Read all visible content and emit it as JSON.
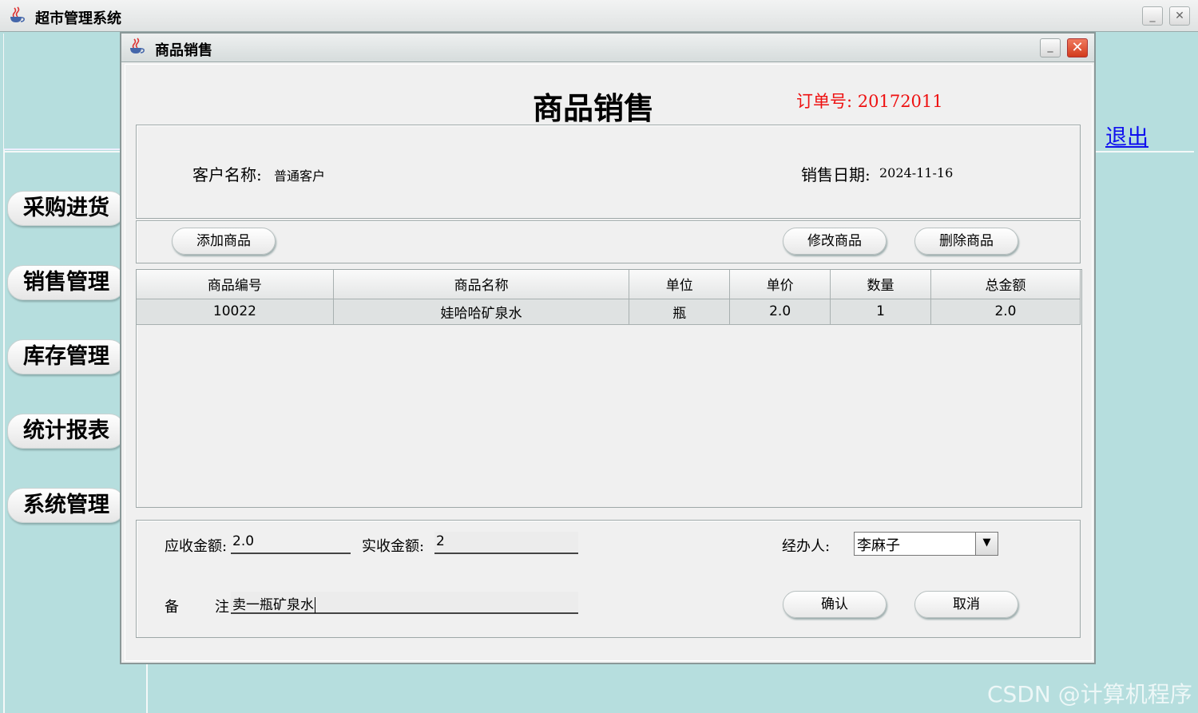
{
  "app": {
    "title": "超市管理系统"
  },
  "sidebar": {
    "items": [
      {
        "label": "采购进货"
      },
      {
        "label": "销售管理"
      },
      {
        "label": "库存管理"
      },
      {
        "label": "统计报表"
      },
      {
        "label": "系统管理"
      }
    ]
  },
  "exit_label": "退出",
  "frame": {
    "title": "商品销售"
  },
  "header": {
    "heading": "商品销售",
    "order_no": "订单号: 20172011"
  },
  "info": {
    "customer_label": "客户名称:",
    "customer_value": "普通客户",
    "date_label": "销售日期:",
    "date_value": "2024-11-16"
  },
  "toolbar": {
    "add_label": "添加商品",
    "edit_label": "修改商品",
    "delete_label": "删除商品"
  },
  "table": {
    "columns": [
      "商品编号",
      "商品名称",
      "单位",
      "单价",
      "数量",
      "总金额"
    ],
    "rows": [
      [
        "10022",
        "娃哈哈矿泉水",
        "瓶",
        "2.0",
        "1",
        "2.0"
      ]
    ]
  },
  "footer": {
    "receivable_label": "应收金额:",
    "receivable_value": "2.0",
    "received_label": "实收金额:",
    "received_value": "2",
    "handler_label": "经办人:",
    "handler_value": "李麻子",
    "remark_label_1": "备",
    "remark_label_2": "注",
    "remark_value": "卖一瓶矿泉水",
    "confirm_label": "确认",
    "cancel_label": "取消"
  },
  "watermark": "CSDN @计算机程序",
  "colors": {
    "order_no": "#ee1111",
    "link": "#1010ee",
    "background": "#b6dede"
  }
}
